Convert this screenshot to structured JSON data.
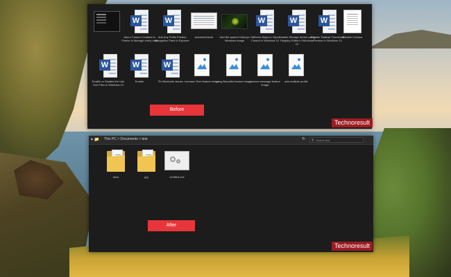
{
  "window_before": {
    "files": [
      {
        "name": "",
        "type": "thumb-dark"
      },
      {
        "name": "Add a Custom Cookies to Firefox to Manage every mail",
        "type": "word"
      },
      {
        "name": "Add Any Prefix Folders Navigation Pane in Explorer",
        "type": "word"
      },
      {
        "name": "Advancements",
        "type": "thumb-white"
      },
      {
        "name": "Add the system Hotkeys Windows image",
        "type": "thumb-green"
      },
      {
        "name": "Different Ways to Open Control in Windows 10",
        "type": "word"
      },
      {
        "name": "Disable Storage Sense using Registry Editor in Windows 10",
        "type": "word"
      },
      {
        "name": "Disable Taskbar Thumbnail Preview in Windows 10",
        "type": "word"
      },
      {
        "name": "Disable Cortana",
        "type": "thumb-page"
      },
      {
        "name": "Enable or Disable the Use Sort Files in Windows 10",
        "type": "word"
      },
      {
        "name": "Enable",
        "type": "word"
      },
      {
        "name": "Fix Bluetooth Issues",
        "type": "word"
      },
      {
        "name": "Increase Size feature image",
        "type": "image"
      },
      {
        "name": "Long Beautiful feature image",
        "type": "image"
      },
      {
        "name": "custom message feature image",
        "type": "image"
      },
      {
        "name": "add multiple profile",
        "type": "image"
      }
    ],
    "button_label": "Before",
    "watermark": "Technoresult"
  },
  "window_after": {
    "breadcrumb": "This PC  >  Documents  >  test",
    "search_placeholder": "Search test",
    "files": [
      {
        "name": "docs",
        "type": "folder"
      },
      {
        "name": "jpg",
        "type": "folder"
      },
      {
        "name": "Untitled.xml",
        "type": "gear"
      }
    ],
    "button_label": "After",
    "watermark": "Technoresult"
  },
  "colors": {
    "accent_red": "#e8353a",
    "window_bg": "#1c1c1c",
    "watermark_bg": "#9c1c22"
  }
}
